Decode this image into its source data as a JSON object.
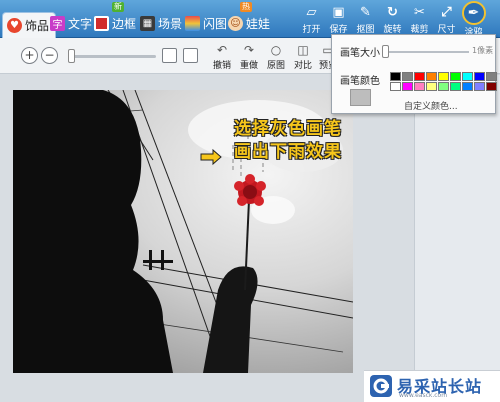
{
  "tabs": [
    {
      "label": "饰品",
      "color": "#e8462e"
    },
    {
      "label": "文字",
      "color": "#c83cc8"
    },
    {
      "label": "边框",
      "color": "#d12c2c",
      "badge": "新"
    },
    {
      "label": "场景",
      "color": "#3a3a3a"
    },
    {
      "label": "闪图",
      "color": "#d9942b"
    },
    {
      "label": "娃娃",
      "color": "#e07a2b"
    }
  ],
  "tools": [
    {
      "label": "打开",
      "icon": "folder-icon"
    },
    {
      "label": "保存",
      "icon": "save-icon"
    },
    {
      "label": "抠图",
      "icon": "cutout-icon"
    },
    {
      "label": "旋转",
      "icon": "rotate-icon"
    },
    {
      "label": "裁剪",
      "icon": "crop-icon"
    },
    {
      "label": "尺寸",
      "icon": "resize-icon"
    },
    {
      "label": "涂鸦",
      "icon": "paintbrush-icon"
    }
  ],
  "editbar": {
    "undo": "撤销",
    "redo": "重做",
    "original": "原图",
    "compare": "对比",
    "preview": "预览"
  },
  "popup": {
    "size_label": "画笔大小",
    "size_value": "1像素",
    "color_label": "画笔颜色",
    "custom_label": "自定义颜色...",
    "selected_color": "#bdbdbd",
    "colors": [
      "#000000",
      "#808080",
      "#ff0000",
      "#ff8000",
      "#ffff00",
      "#00ff00",
      "#00ffff",
      "#0000ff",
      "#808080",
      "#ffffff",
      "#ff00ff",
      "#ff80c0",
      "#ffff80",
      "#80ff80",
      "#00ff80",
      "#0080ff",
      "#8080ff",
      "#800000"
    ]
  },
  "annotation": {
    "line1": "选择灰色画笔",
    "line2": "画出下雨效果"
  },
  "watermark": {
    "name": "易采站长站",
    "url": "www.easck.com"
  }
}
